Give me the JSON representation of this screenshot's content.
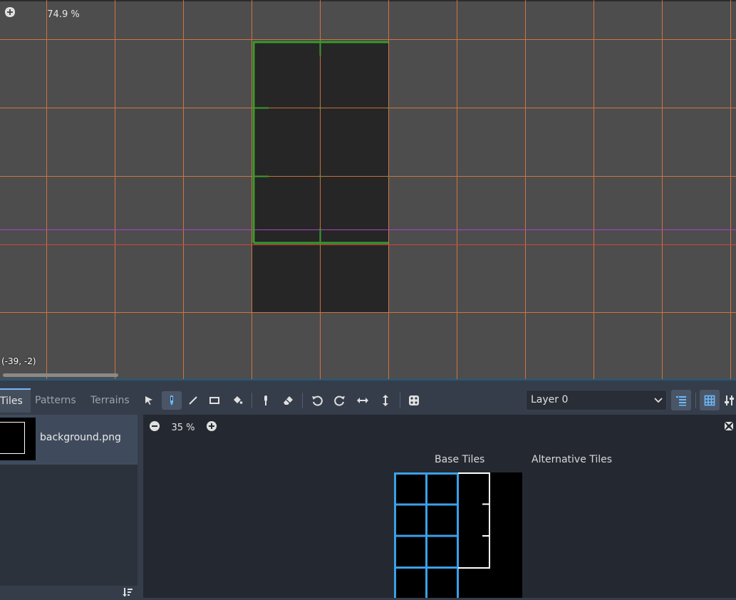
{
  "viewport": {
    "zoom_label": "74.9 %",
    "cursor_coords": "(-39, -2)",
    "icons": [
      "center-view-icon",
      "zoom-out-icon",
      "zoom-in-icon"
    ]
  },
  "bottom_panel": {
    "tabs": [
      {
        "label": "Tiles",
        "active": true
      },
      {
        "label": "Patterns",
        "active": false
      },
      {
        "label": "Terrains",
        "active": false
      }
    ],
    "tools": [
      "select-icon",
      "paint-icon",
      "line-icon",
      "rect-icon",
      "bucket-icon",
      "picker-icon",
      "eraser-icon",
      "rotate-left-icon",
      "rotate-right-icon",
      "flip-h-icon",
      "flip-v-icon",
      "random-icon"
    ],
    "active_tool": "paint-icon",
    "layer_select": {
      "value": "Layer 0"
    },
    "sources": [
      {
        "name": "background.png"
      }
    ],
    "atlas": {
      "zoom_label": "35 %",
      "base_tiles_label": "Base Tiles",
      "alternative_tiles_label": "Alternative Tiles"
    }
  },
  "colors": {
    "grid_line": "#e87a3e",
    "selection": "#3a9c2c",
    "axis_x": "#b040c8",
    "tile_highlight": "#3ba0e8",
    "editor_bg": "#363d4a"
  }
}
